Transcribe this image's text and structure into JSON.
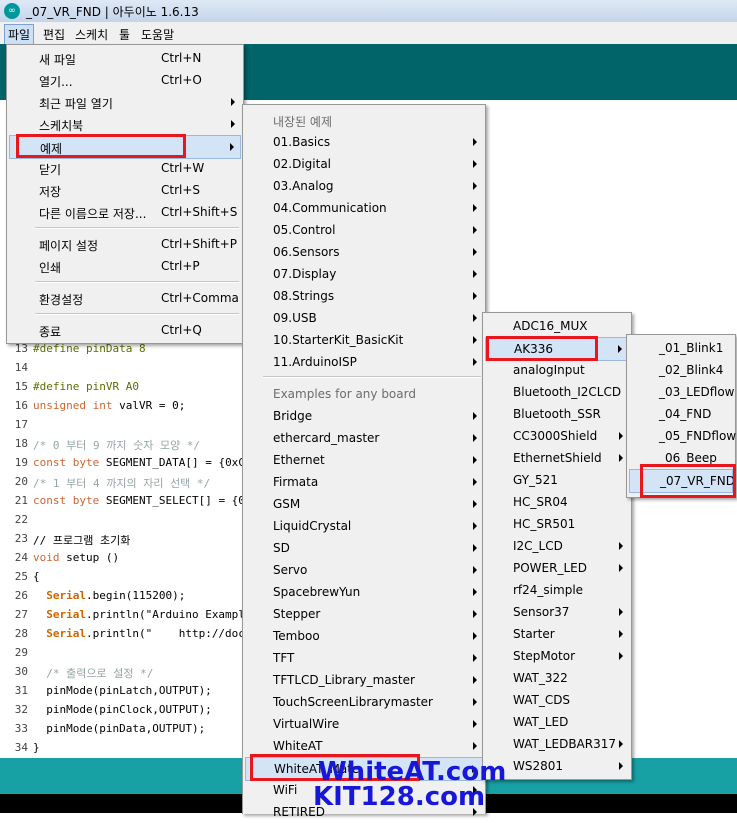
{
  "window": {
    "title": "_07_VR_FND | 아두이노 1.6.13"
  },
  "menubar": [
    "파일",
    "편집",
    "스케치",
    "툴",
    "도움말"
  ],
  "file_menu": [
    {
      "label": "새 파일",
      "shortcut": "Ctrl+N"
    },
    {
      "label": "열기...",
      "shortcut": "Ctrl+O"
    },
    {
      "label": "최근 파일 열기",
      "shortcut": ""
    },
    {
      "label": "스케치북",
      "shortcut": ""
    },
    {
      "label": "예제",
      "shortcut": ""
    },
    {
      "label": "닫기",
      "shortcut": "Ctrl+W"
    },
    {
      "label": "저장",
      "shortcut": "Ctrl+S"
    },
    {
      "label": "다른 이름으로 저장...",
      "shortcut": "Ctrl+Shift+S"
    },
    {
      "label": "페이지 설정",
      "shortcut": "Ctrl+Shift+P"
    },
    {
      "label": "인쇄",
      "shortcut": "Ctrl+P"
    },
    {
      "label": "환경설정",
      "shortcut": "Ctrl+Comma"
    },
    {
      "label": "종료",
      "shortcut": "Ctrl+Q"
    }
  ],
  "examples_menu": {
    "builtin_header": "내장된 예제",
    "builtin": [
      "01.Basics",
      "02.Digital",
      "03.Analog",
      "04.Communication",
      "05.Control",
      "06.Sensors",
      "07.Display",
      "08.Strings",
      "09.USB",
      "10.StarterKit_BasicKit",
      "11.ArduinoISP"
    ],
    "any_board_header": "Examples for any board",
    "any_board": [
      "Bridge",
      "ethercard_master",
      "Ethernet",
      "Firmata",
      "GSM",
      "LiquidCrystal",
      "SD",
      "Servo",
      "SpacebrewYun",
      "Stepper",
      "Temboo",
      "TFT",
      "TFTLCD_Library_master",
      "TouchScreenLibrarymaster",
      "VirtualWire",
      "WhiteAT",
      "WhiteAT_Mate",
      "WiFi",
      "RETIRED"
    ]
  },
  "whiteat_menu": [
    "ADC16_MUX",
    "AK336",
    "analogInput",
    "Bluetooth_I2CLCD",
    "Bluetooth_SSR",
    "CC3000Shield",
    "EthernetShield",
    "GY_521",
    "HC_SR04",
    "HC_SR501",
    "I2C_LCD",
    "POWER_LED",
    "rf24_simple",
    "Sensor37",
    "Starter",
    "StepMotor",
    "WAT_322",
    "WAT_CDS",
    "WAT_LED",
    "WAT_LEDBAR317",
    "WS2801"
  ],
  "ak336_menu": [
    "_01_Blink1",
    "_02_Blink4",
    "_03_LEDflow",
    "_04_FND",
    "_05_FNDflow",
    "_06_Beep",
    "_07_VR_FND"
  ],
  "code": {
    "line_numbers": [
      "13",
      "14",
      "15",
      "16",
      "17",
      "18",
      "19",
      "20",
      "21",
      "22",
      "23",
      "24",
      "25",
      "26",
      "27",
      "28",
      "29",
      "30",
      "31",
      "32",
      "33",
      "34"
    ],
    "l13": "#define pinData 8",
    "l15": "#define pinVR A0",
    "l16a": "unsigned int",
    "l16b": " valVR = 0;",
    "l18": "/* 0 부터 9 까지 숫자 모양 */",
    "l19a": "const byte",
    "l19b": " SEGMENT_DATA[] = {0xC0,0",
    "l20": "/* 1 부터 4 까지의 자리 선택 */",
    "l21a": "const byte",
    "l21b": " SEGMENT_SELECT[] = {0xF",
    "l23": "// 프로그램 초기화",
    "l24a": "void",
    "l24b": " setup ()",
    "l25": "{",
    "l26a": "  Serial",
    "l26b": ".begin(115200);",
    "l27a": "  Serial",
    "l27b": ".println(\"Arduino Examples",
    "l28a": "  Serial",
    "l28b": ".println(\"    http://docs",
    "l30": "  /* 출력으로 설정 */",
    "l31": "  pinMode(pinLatch,OUTPUT);",
    "l32": "  pinMode(pinClock,OUTPUT);",
    "l33": "  pinMode(pinData,OUTPUT);",
    "l34": "}"
  },
  "watermark": [
    "WhiteAT.com",
    "KIT128.com"
  ],
  "colors": {
    "toolbar": "#006468",
    "status": "#17a1a5",
    "highlight_box": "#e8161d",
    "watermark": "#1717d9"
  }
}
